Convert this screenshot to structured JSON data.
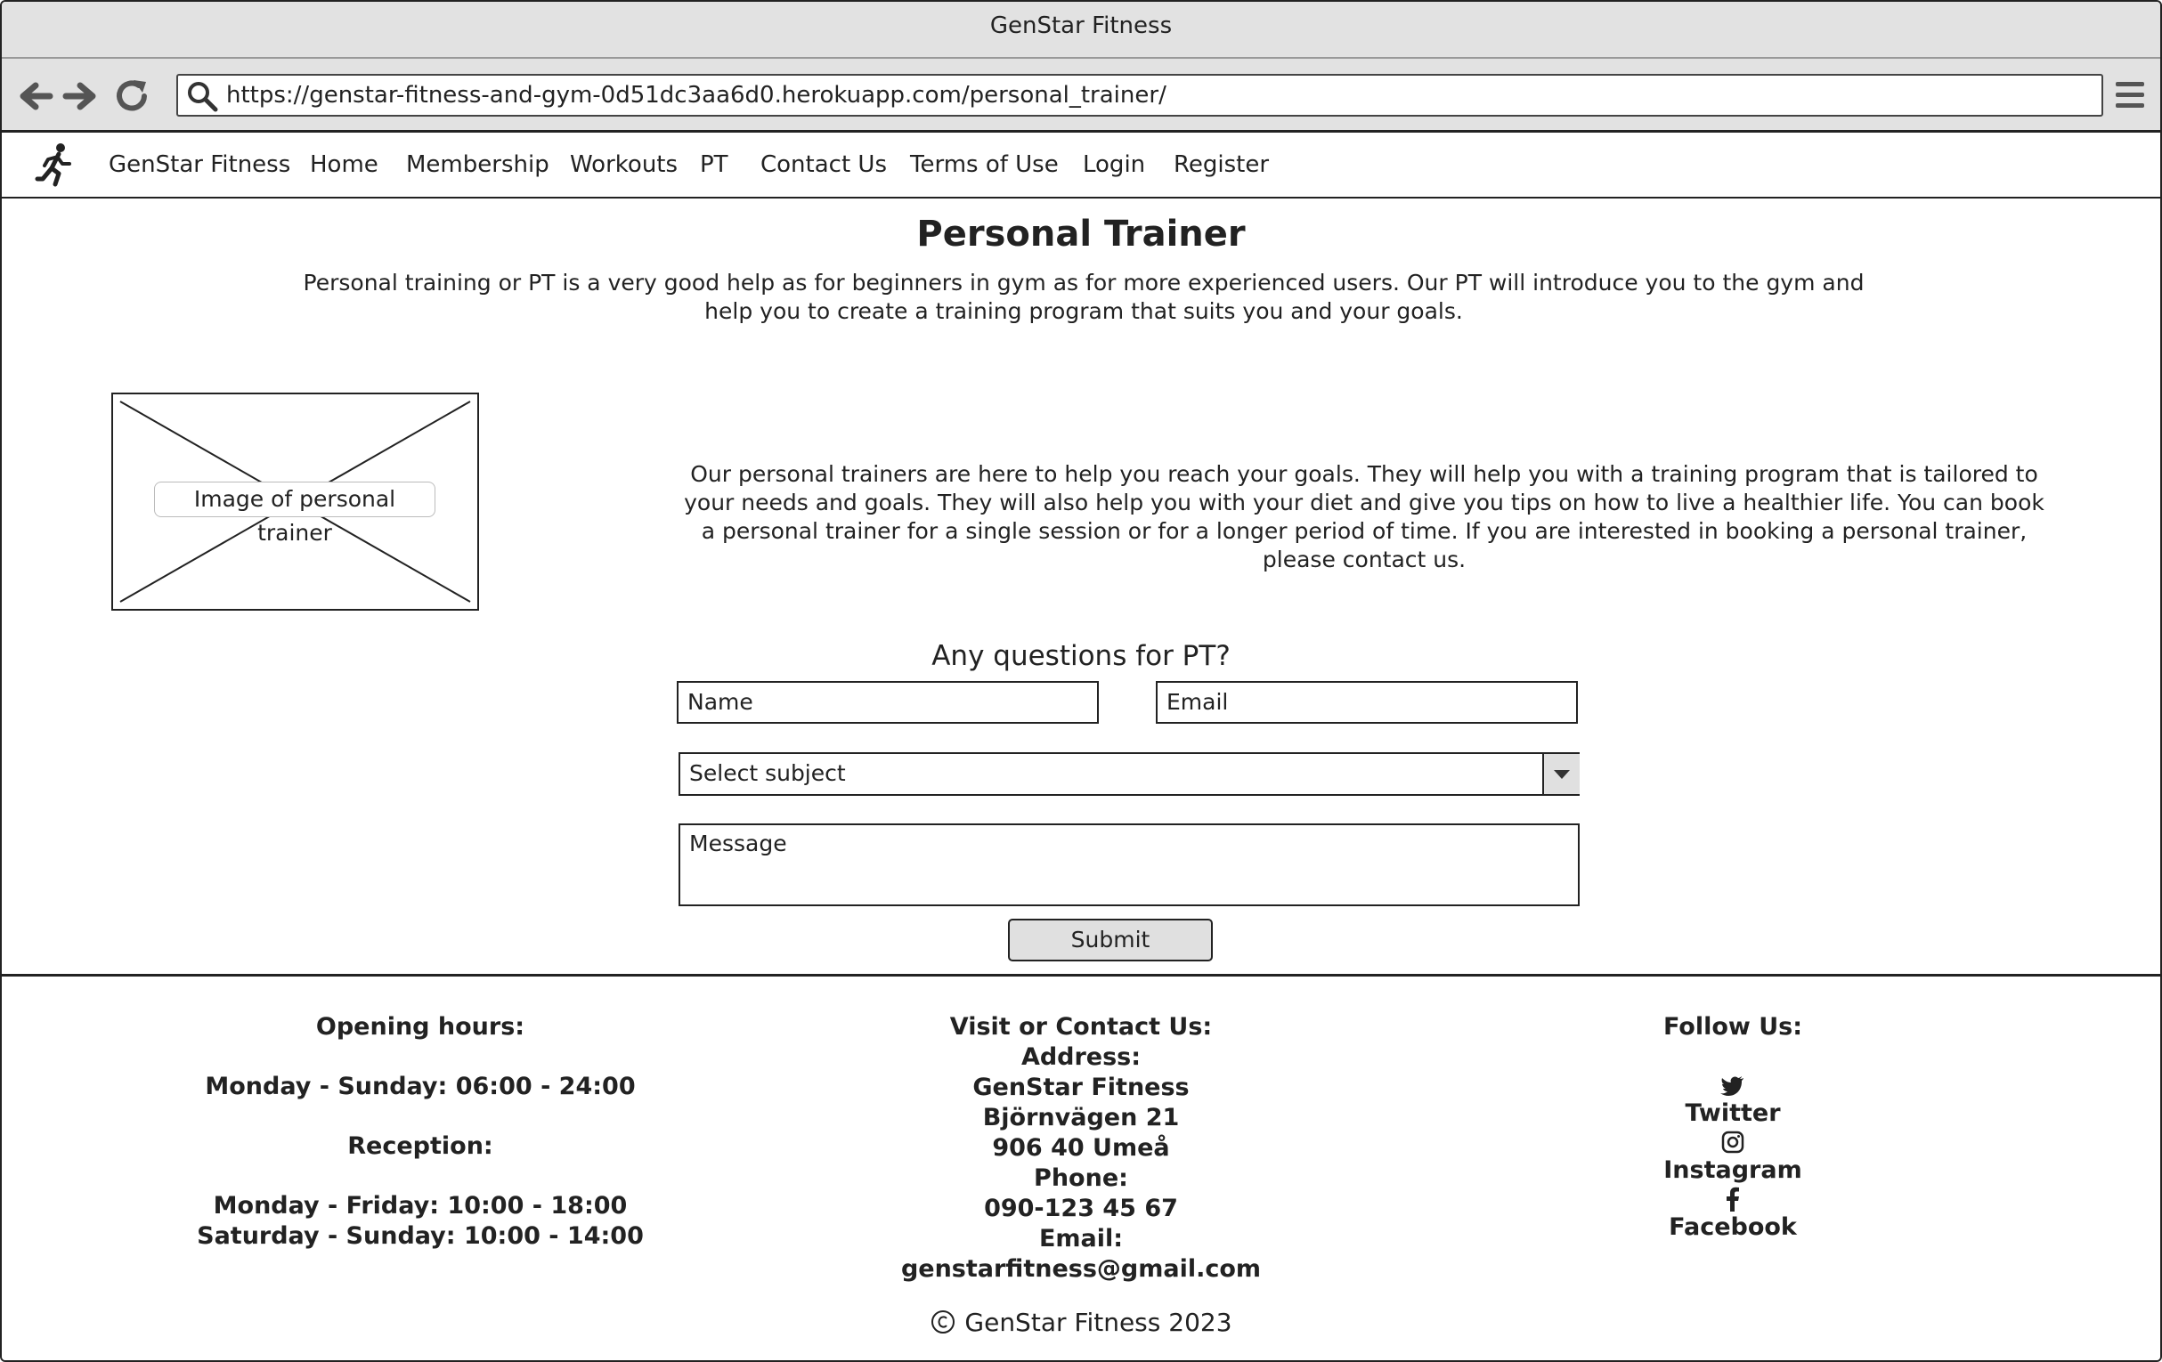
{
  "browser": {
    "window_title": "GenStar Fitness",
    "url": "https://genstar-fitness-and-gym-0d51dc3aa6d0.herokuapp.com/personal_trainer/"
  },
  "nav": {
    "brand": "GenStar Fitness",
    "items": [
      {
        "label": "Home"
      },
      {
        "label": "Membership"
      },
      {
        "label": "Workouts"
      },
      {
        "label": "PT"
      },
      {
        "label": "Contact Us"
      },
      {
        "label": "Terms of Use"
      },
      {
        "label": "Login"
      },
      {
        "label": "Register"
      }
    ]
  },
  "main": {
    "title": "Personal Trainer",
    "intro": "Personal training or PT is a very good help as for beginners in gym as for more experienced users. Our PT will introduce you to the gym and help you to create a training program that suits you and your goals.",
    "image_label": "Image of personal trainer",
    "description": "Our personal trainers are here to help you reach your goals. They will help you with a training program that is tailored to your needs and goals. They will also help you with your diet and give you tips on how to live a healthier life. You can book a personal trainer for a single session or for a longer period of time. If you are interested in booking a personal trainer, please contact us."
  },
  "form": {
    "title": "Any questions for PT?",
    "name_placeholder": "Name",
    "email_placeholder": "Email",
    "subject_value": "Select subject",
    "message_placeholder": "Message",
    "submit_label": "Submit"
  },
  "footer": {
    "hours": {
      "heading": "Opening hours:",
      "open": "Monday - Sunday: 06:00 - 24:00",
      "reception_heading": "Reception:",
      "weekdays": "Monday - Friday: 10:00 - 18:00",
      "weekend": "Saturday - Sunday: 10:00 - 14:00"
    },
    "contact": {
      "heading": "Visit or Contact Us:",
      "address_label": "Address:",
      "name": "GenStar Fitness",
      "street": "Björnvägen 21",
      "city": "906 40 Umeå",
      "phone_label": "Phone:",
      "phone": "090-123 45 67",
      "email_label": "Email:",
      "email": "genstarfitness@gmail.com"
    },
    "follow": {
      "heading": "Follow Us:",
      "twitter": "Twitter",
      "instagram": "Instagram",
      "facebook": "Facebook"
    },
    "copyright": "GenStar Fitness 2023"
  }
}
